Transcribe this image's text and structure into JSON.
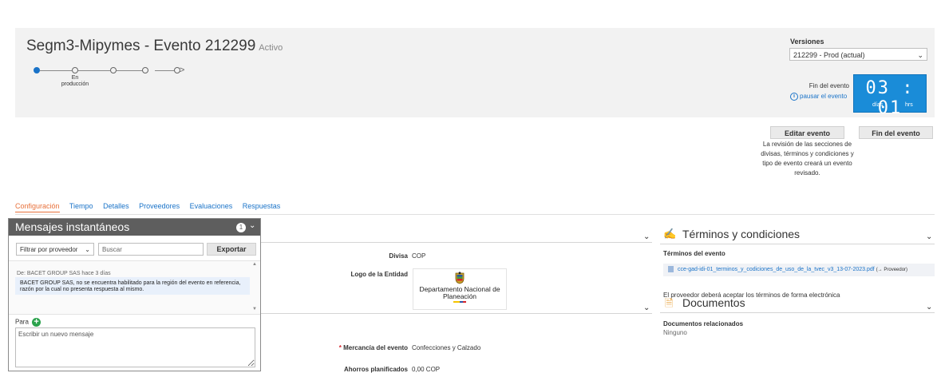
{
  "header": {
    "title": "Segm3-Mipymes - Evento 212299",
    "status": "Activo",
    "progress_step_label": "En producción",
    "versions_label": "Versiones",
    "versions_selected": "212299 - Prod (actual)",
    "event_end_label": "Fin del evento",
    "pause_label": "pausar el evento",
    "timer": {
      "value": "03 : 01",
      "unit_days": "días",
      "unit_hours": "hrs"
    }
  },
  "actions": {
    "edit_event": "Editar evento",
    "end_event": "Fin del evento",
    "edit_note": "La revisión de las secciones de divisas, términos y condiciones y tipo de evento creará un evento revisado."
  },
  "tabs": [
    {
      "label": "Configuración",
      "active": true
    },
    {
      "label": "Tiempo",
      "active": false
    },
    {
      "label": "Detalles",
      "active": false
    },
    {
      "label": "Proveedores",
      "active": false
    },
    {
      "label": "Evaluaciones",
      "active": false
    },
    {
      "label": "Respuestas",
      "active": false
    }
  ],
  "config": {
    "currency_label": "Divisa",
    "currency_value": "COP",
    "logo_label": "Logo de la Entidad",
    "logo_text": "Departamento Nacional de Planeación",
    "required_mark": "*",
    "merchandise_label": "Mercancía del evento",
    "merchandise_value": "Confecciones y Calzado",
    "savings_label": "Ahorros planificados",
    "savings_value": "0,00 COP"
  },
  "terms": {
    "title": "Términos y condiciones",
    "subheading": "Términos del evento",
    "file_name": "cce-gad-idi-01_terminos_y_codiciones_de_uso_de_la_tvec_v3_13-07-2023.pdf",
    "file_suffix": "(→ Proveedor)",
    "acceptance_note": "El proveedor deberá aceptar los términos de forma electrónica"
  },
  "documents": {
    "title": "Documentos",
    "subheading": "Documentos relacionados",
    "value": "Ninguno"
  },
  "chat": {
    "title": "Mensajes instantáneos",
    "badge_count": "1",
    "filter_label": "Filtrar por proveedor",
    "search_placeholder": "Buscar",
    "export_label": "Exportar",
    "message_meta": "De: BACET GROUP SAS hace 3 días",
    "message_text": "BACET GROUP SAS, no se encuentra habilitado para la región del evento en referencia, razón por la cual no presenta respuesta al mismo.",
    "to_label": "Para",
    "compose_placeholder": "Escribir un nuevo mensaje"
  },
  "colors": {
    "accent": "#1a73c8",
    "active_tab": "#e8713b",
    "timer_bg": "#1a8cd8",
    "chat_header": "#5e5e5e",
    "add_green": "#2ba24c"
  },
  "icons": {
    "dropdown": "chevron-down-icon",
    "pause": "pause-icon",
    "terms": "handshake-icon",
    "documents": "document-icon",
    "file": "pdf-file-icon",
    "add_recipient": "plus-circle-icon",
    "chat_collapse": "chevron-down-icon"
  }
}
